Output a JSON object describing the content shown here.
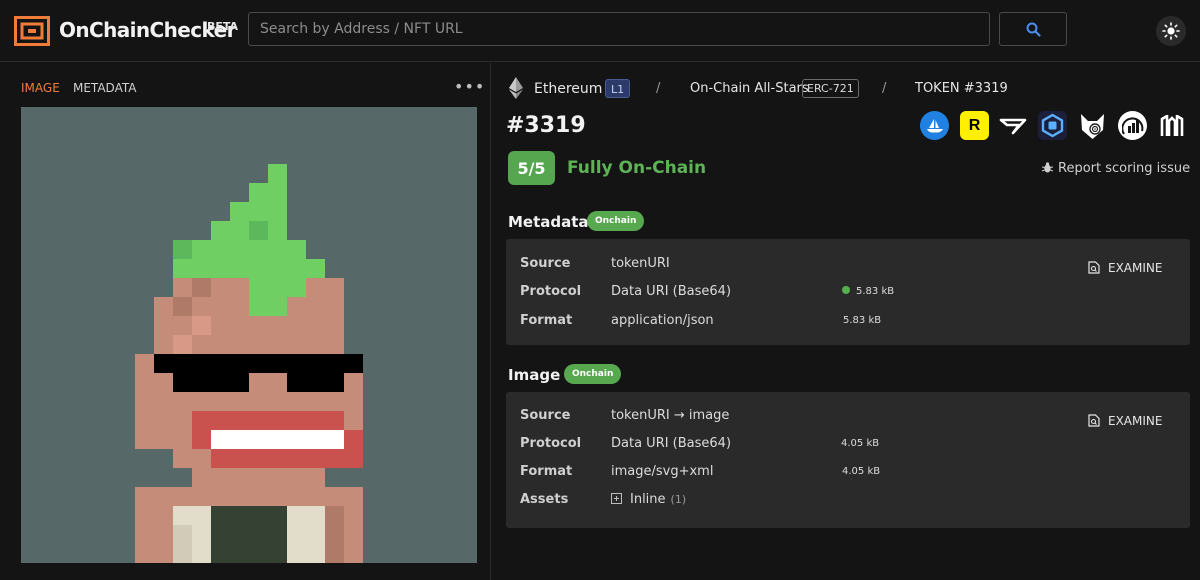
{
  "header": {
    "brand": "OnChainChecker",
    "beta": "BETA",
    "search_placeholder": "Search by Address / NFT URL",
    "search_icon": "search-icon",
    "theme_icon": "sun-icon"
  },
  "left": {
    "tabs": [
      {
        "label": "IMAGE",
        "active": true
      },
      {
        "label": "METADATA",
        "active": false
      }
    ],
    "more_icon": "ellipsis-icon"
  },
  "breadcrumb": {
    "chain": "Ethereum",
    "chain_badge": "L1",
    "collection": "On-Chain All-Stars",
    "standard": "ERC-721",
    "token": "TOKEN #3319",
    "separator": "/"
  },
  "token": {
    "title": "#3319",
    "score": "5/5",
    "score_label": "Fully On-Chain",
    "report": "Report scoring issue",
    "marketplaces": [
      "opensea-icon",
      "rarible-icon",
      "x2y2-icon",
      "looksrare-icon",
      "blur-icon",
      "etherscan-icon",
      "magic-eden-icon"
    ]
  },
  "metadata": {
    "title": "Metadata",
    "badge": "Onchain",
    "examine": "EXAMINE",
    "rows": [
      {
        "key": "Source",
        "value": "tokenURI",
        "size": ""
      },
      {
        "key": "Protocol",
        "value": "Data URI (Base64)",
        "size": "5.83 kB"
      },
      {
        "key": "Format",
        "value": "application/json",
        "size": "5.83 kB"
      }
    ]
  },
  "image": {
    "title": "Image",
    "badge": "Onchain",
    "examine": "EXAMINE",
    "rows": [
      {
        "key": "Source",
        "value": "tokenURI → image",
        "size": ""
      },
      {
        "key": "Protocol",
        "value": "Data URI (Base64)",
        "size": "4.05 kB"
      },
      {
        "key": "Format",
        "value": "image/svg+xml",
        "size": "4.05 kB"
      }
    ],
    "assets_key": "Assets",
    "assets_value": "Inline",
    "assets_count": "(1)"
  },
  "colors": {
    "accent_orange": "#f07c3a",
    "onchain_green": "#58a84f",
    "art_background": "#566968"
  }
}
